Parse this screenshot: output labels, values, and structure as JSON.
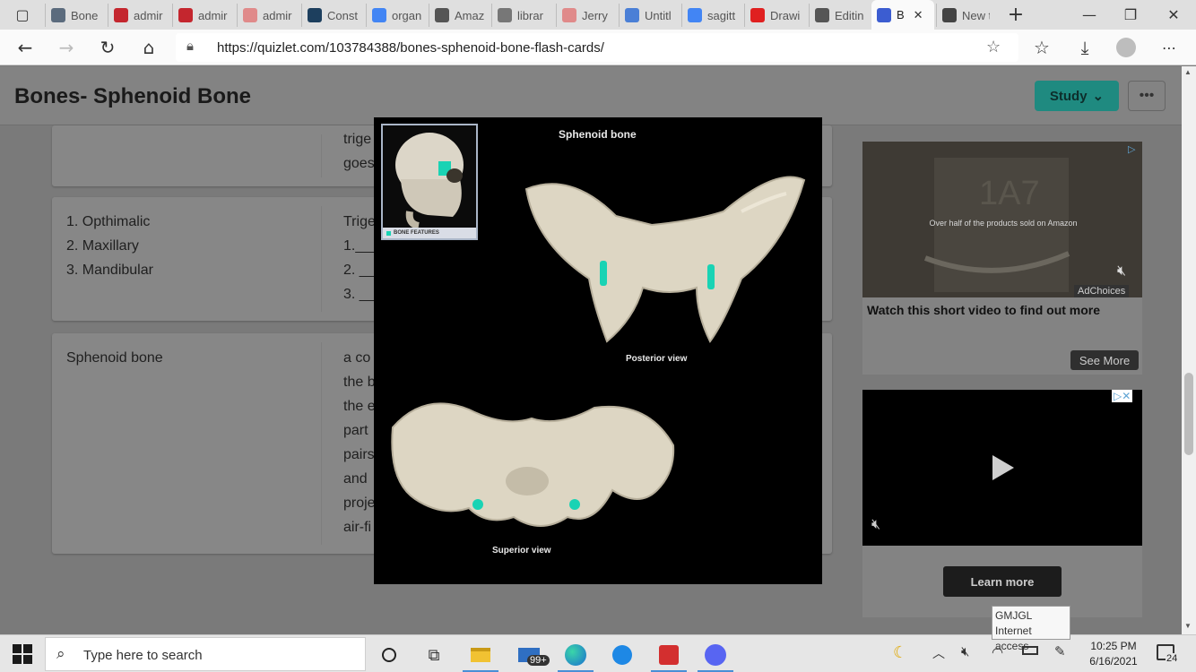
{
  "browser": {
    "tabs": [
      {
        "label": "Bone",
        "icon": "image-tab-icon",
        "color": "#5b6b7d"
      },
      {
        "label": "admir",
        "icon": "pdf-icon",
        "color": "#c4262e"
      },
      {
        "label": "admir",
        "icon": "pdf-icon",
        "color": "#c4262e"
      },
      {
        "label": "admir",
        "icon": "pdf-icon",
        "color": "#e08a8a"
      },
      {
        "label": "Const",
        "icon": "book-icon",
        "color": "#1d3f5e"
      },
      {
        "label": "organ",
        "icon": "google-icon",
        "color": "#4285f4"
      },
      {
        "label": "Amaz",
        "icon": "amazon-icon",
        "color": "#555555"
      },
      {
        "label": "librar",
        "icon": "document-icon",
        "color": "#777777"
      },
      {
        "label": "Jerry",
        "icon": "pdf-icon",
        "color": "#e08a8a"
      },
      {
        "label": "Untitl",
        "icon": "docs-icon",
        "color": "#4a7fd6"
      },
      {
        "label": "sagitt",
        "icon": "google-icon",
        "color": "#4285f4"
      },
      {
        "label": "Drawi",
        "icon": "youtube-icon",
        "color": "#e02020"
      },
      {
        "label": "Editin",
        "icon": "globe-icon",
        "color": "#555555"
      },
      {
        "label": "B",
        "icon": "quizlet-icon",
        "color": "#3c5dd1"
      },
      {
        "label": "New t",
        "icon": "newtab-icon",
        "color": "#444444"
      }
    ],
    "url": "https://quizlet.com/103784388/bones-sphenoid-bone-flash-cards/"
  },
  "page": {
    "title": "Bones- Sphenoid Bone",
    "study_label": "Study",
    "more_label": "•••",
    "cards": [
      {
        "term_lines": [],
        "def_lines": [
          "trige",
          "goes"
        ]
      },
      {
        "term_lines": [
          "1. Opthimalic",
          "2. Maxillary",
          "3. Mandibular"
        ],
        "def_lines": [
          "Trige",
          "1.___",
          "2. __",
          "3. __"
        ]
      },
      {
        "term_lines": [
          "Sphenoid bone"
        ],
        "def_lines": [
          "a co",
          "the b",
          "the e",
          "part",
          "pairs",
          "and",
          "proje",
          "air-fi"
        ]
      }
    ]
  },
  "modal": {
    "title": "Sphenoid bone",
    "posterior_label": "Posterior view",
    "superior_label": "Superior view",
    "thumb_label": "BONE FEATURES",
    "accent": "#19d3b4"
  },
  "ads": {
    "ad1": {
      "overlay": "Over half of the products sold on Amazon",
      "choices": "AdChoices",
      "headline": "Watch this short video to find out more",
      "cta": "See More"
    },
    "ad2": {
      "cta": "Learn more"
    }
  },
  "taskbar": {
    "search_placeholder": "Type here to search",
    "mail_badge": "99+",
    "time": "10:25 PM",
    "date": "6/16/2021",
    "notifications": "24"
  },
  "tooltip": {
    "line1": "GMJGL",
    "line2": "Internet access"
  }
}
